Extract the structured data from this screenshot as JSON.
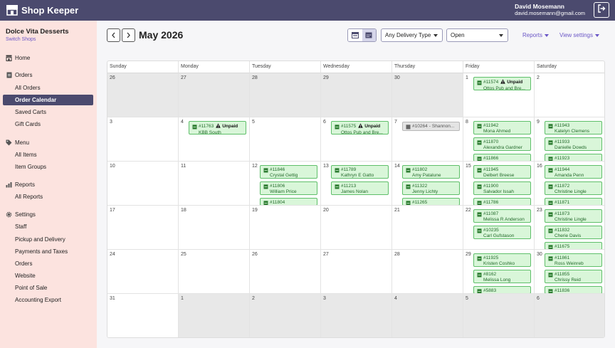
{
  "app": {
    "name": "Shop Keeper"
  },
  "user": {
    "name": "David Mosemann",
    "email": "david.mosemann@gmail.com"
  },
  "shop": {
    "name": "Dolce Vita Desserts",
    "switch_label": "Switch Shops"
  },
  "sidebar": {
    "home": "Home",
    "orders_header": "Orders",
    "orders": [
      "All Orders",
      "Order Calendar",
      "Saved Carts",
      "Gift Cards"
    ],
    "menu_header": "Menu",
    "menu": [
      "All Items",
      "Item Groups"
    ],
    "reports_header": "Reports",
    "reports": [
      "All Reports"
    ],
    "settings_header": "Settings",
    "settings": [
      "Staff",
      "Pickup and Delivery",
      "Payments and Taxes",
      "Orders",
      "Website",
      "Point of Sale",
      "Accounting Export"
    ],
    "active_item": "Order Calendar"
  },
  "toolbar": {
    "month_title": "May 2026",
    "delivery_filter": "Any Delivery Type",
    "status_filter": "Open",
    "reports_label": "Reports",
    "view_settings_label": "View settings"
  },
  "colors": {
    "topbar": "#4b4a6e",
    "sidebar": "#fce3df",
    "accent": "#6a56c6",
    "event_bg": "#d9f6d9",
    "event_border": "#5fbf6a"
  },
  "calendar": {
    "weekdays": [
      "Sunday",
      "Monday",
      "Tuesday",
      "Wednesday",
      "Thursday",
      "Friday",
      "Saturday"
    ],
    "weeks": [
      [
        {
          "day": "26",
          "other": true,
          "events": []
        },
        {
          "day": "27",
          "other": true,
          "events": []
        },
        {
          "day": "28",
          "other": true,
          "events": []
        },
        {
          "day": "29",
          "other": true,
          "events": []
        },
        {
          "day": "30",
          "other": true,
          "events": []
        },
        {
          "day": "1",
          "events": [
            {
              "id": "#11574",
              "name": "Ottos Pub and Bre...",
              "unpaid": "Unpaid"
            }
          ]
        },
        {
          "day": "2",
          "events": []
        }
      ],
      [
        {
          "day": "3",
          "events": []
        },
        {
          "day": "4",
          "events": [
            {
              "id": "#11763",
              "name": "KBB South",
              "unpaid": "Unpaid"
            }
          ]
        },
        {
          "day": "5",
          "events": []
        },
        {
          "day": "6",
          "events": [
            {
              "id": "#11575",
              "name": "Ottos Pub and Bre...",
              "unpaid": "Unpaid"
            }
          ]
        },
        {
          "day": "7",
          "events": [
            {
              "id": "#10264",
              "name": "Shannon...",
              "gray": true
            }
          ]
        },
        {
          "day": "8",
          "events": [
            {
              "id": "#11942",
              "name": "Mona Ahmed"
            },
            {
              "id": "#11870",
              "name": "Alexandra Gardner"
            },
            {
              "id": "#11866",
              "name": "",
              "clip": true
            }
          ]
        },
        {
          "day": "9",
          "events": [
            {
              "id": "#11943",
              "name": "Katelyn Clemens"
            },
            {
              "id": "#11933",
              "name": "Danielle Dowds"
            },
            {
              "id": "#11923",
              "name": "",
              "clip": true
            }
          ]
        }
      ],
      [
        {
          "day": "10",
          "events": []
        },
        {
          "day": "11",
          "events": []
        },
        {
          "day": "12",
          "events": [
            {
              "id": "#11846",
              "name": "Crystal Gettig"
            },
            {
              "id": "#11806",
              "name": "William Price"
            },
            {
              "id": "#11804",
              "name": "",
              "clip": true
            }
          ]
        },
        {
          "day": "13",
          "events": [
            {
              "id": "#11789",
              "name": "Kathryn E Gatto"
            },
            {
              "id": "#11213",
              "name": "James Nolan"
            }
          ]
        },
        {
          "day": "14",
          "events": [
            {
              "id": "#11802",
              "name": "Amy Patalune"
            },
            {
              "id": "#11322",
              "name": "Jenny Lichty"
            },
            {
              "id": "#11265",
              "name": "",
              "clip": true
            }
          ]
        },
        {
          "day": "15",
          "events": [
            {
              "id": "#11945",
              "name": "Delbert Breese"
            },
            {
              "id": "#11900",
              "name": "Salvador Issah"
            },
            {
              "id": "#11786",
              "name": "",
              "clip": true
            }
          ]
        },
        {
          "day": "16",
          "events": [
            {
              "id": "#11944",
              "name": "Amanda Penn"
            },
            {
              "id": "#11872",
              "name": "Christine Lingle"
            },
            {
              "id": "#11871",
              "name": "",
              "clip": true
            }
          ]
        }
      ],
      [
        {
          "day": "17",
          "events": []
        },
        {
          "day": "18",
          "events": []
        },
        {
          "day": "19",
          "events": []
        },
        {
          "day": "20",
          "events": []
        },
        {
          "day": "21",
          "events": []
        },
        {
          "day": "22",
          "events": [
            {
              "id": "#11087",
              "name": "Melissa R Anderson"
            },
            {
              "id": "#10235",
              "name": "Carl Gufstason"
            }
          ]
        },
        {
          "day": "23",
          "events": [
            {
              "id": "#11873",
              "name": "Christine Lingle"
            },
            {
              "id": "#11832",
              "name": "Cherie Davis"
            },
            {
              "id": "#11675",
              "name": "",
              "clip": true
            }
          ]
        }
      ],
      [
        {
          "day": "24",
          "events": []
        },
        {
          "day": "25",
          "events": []
        },
        {
          "day": "26",
          "events": []
        },
        {
          "day": "27",
          "events": []
        },
        {
          "day": "28",
          "events": []
        },
        {
          "day": "29",
          "events": [
            {
              "id": "#11925",
              "name": "Kristen Coshko"
            },
            {
              "id": "#8162",
              "name": "Melissa Long"
            },
            {
              "id": "#5883",
              "name": "",
              "clip": true
            }
          ]
        },
        {
          "day": "30",
          "events": [
            {
              "id": "#11861",
              "name": "Ross Weinreb"
            },
            {
              "id": "#11855",
              "name": "Chrissy Reid"
            },
            {
              "id": "#11836",
              "name": "",
              "clip": true
            }
          ]
        }
      ],
      [
        {
          "day": "31",
          "events": []
        },
        {
          "day": "1",
          "other": true,
          "events": []
        },
        {
          "day": "2",
          "other": true,
          "events": []
        },
        {
          "day": "3",
          "other": true,
          "events": []
        },
        {
          "day": "4",
          "other": true,
          "events": []
        },
        {
          "day": "5",
          "other": true,
          "events": []
        },
        {
          "day": "6",
          "other": true,
          "events": []
        }
      ]
    ]
  }
}
